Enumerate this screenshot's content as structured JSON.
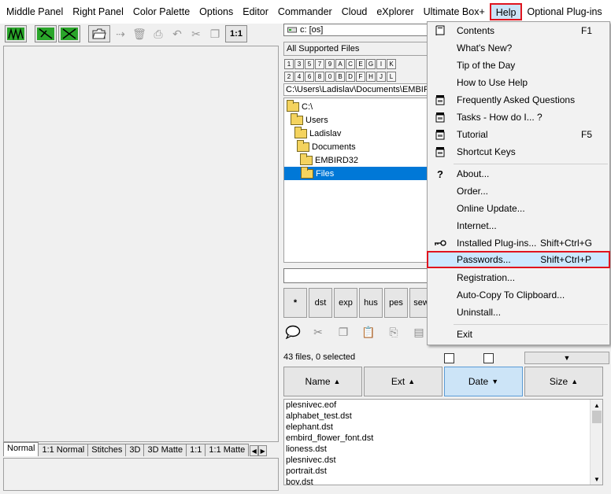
{
  "menubar": {
    "items": [
      {
        "label": "Middle Panel"
      },
      {
        "label": "Right Panel"
      },
      {
        "label": "Color Palette"
      },
      {
        "label": "Options"
      },
      {
        "label": "Editor"
      },
      {
        "label": "Commander"
      },
      {
        "label": "Cloud"
      },
      {
        "label": "eXplorer"
      },
      {
        "label": "Ultimate Box+"
      },
      {
        "label": "Help"
      },
      {
        "label": "Optional Plug-ins"
      }
    ]
  },
  "toolbar": {
    "zoom_label": "1:1"
  },
  "left_tabs": [
    {
      "label": "Normal"
    },
    {
      "label": "1:1 Normal"
    },
    {
      "label": "Stitches"
    },
    {
      "label": "3D"
    },
    {
      "label": "3D Matte"
    },
    {
      "label": "1:1"
    },
    {
      "label": "1:1 Matte"
    }
  ],
  "right_panel": {
    "drive": "c: [os]",
    "filter": "All Supported Files",
    "keys_row1": [
      "1",
      "3",
      "5",
      "7",
      "9",
      "A",
      "C",
      "E",
      "G",
      "I",
      "K"
    ],
    "keys_row2": [
      "2",
      "4",
      "6",
      "8",
      "0",
      "B",
      "D",
      "F",
      "H",
      "J",
      "L"
    ],
    "path": "C:\\Users\\Ladislav\\Documents\\EMBIRD",
    "tree": [
      {
        "label": "C:\\"
      },
      {
        "label": "Users"
      },
      {
        "label": "Ladislav"
      },
      {
        "label": "Documents"
      },
      {
        "label": "EMBIRD32"
      },
      {
        "label": "Files"
      }
    ],
    "ext_buttons": [
      "*",
      "dst",
      "exp",
      "hus",
      "pes",
      "sew"
    ],
    "files_count": "43 files, 0 selected",
    "sort_buttons": [
      {
        "label": "Name",
        "arrow": "▲"
      },
      {
        "label": "Ext",
        "arrow": "▲"
      },
      {
        "label": "Date",
        "arrow": "▼"
      },
      {
        "label": "Size",
        "arrow": "▲"
      }
    ],
    "files": [
      "plesnivec.eof",
      "alphabet_test.dst",
      "elephant.dst",
      "embird_flower_font.dst",
      "lioness.dst",
      "plesnivec.dst",
      "portrait.dst",
      "boy.dst"
    ]
  },
  "help_menu": {
    "items": [
      {
        "label": "Contents",
        "shortcut": "F1",
        "icon": "book-icon"
      },
      {
        "label": "What's New?",
        "shortcut": ""
      },
      {
        "label": "Tip of the Day",
        "shortcut": ""
      },
      {
        "label": "How to Use Help",
        "shortcut": ""
      },
      {
        "label": "Frequently Asked Questions",
        "shortcut": "",
        "icon": "video-icon"
      },
      {
        "label": "Tasks - How do I... ?",
        "shortcut": "",
        "icon": "video-icon"
      },
      {
        "label": "Tutorial",
        "shortcut": "F5",
        "icon": "video-icon"
      },
      {
        "label": "Shortcut Keys",
        "shortcut": "",
        "icon": "video-icon"
      },
      {
        "label": "About...",
        "shortcut": "",
        "icon": "question-icon"
      },
      {
        "label": "Order...",
        "shortcut": ""
      },
      {
        "label": "Online Update...",
        "shortcut": ""
      },
      {
        "label": "Internet...",
        "shortcut": ""
      },
      {
        "label": "Installed Plug-ins...",
        "shortcut": "Shift+Ctrl+G",
        "icon": "key-icon"
      },
      {
        "label": "Passwords...",
        "shortcut": "Shift+Ctrl+P"
      },
      {
        "label": "Registration...",
        "shortcut": ""
      },
      {
        "label": "Auto-Copy To Clipboard...",
        "shortcut": ""
      },
      {
        "label": "Uninstall...",
        "shortcut": ""
      },
      {
        "label": "Exit",
        "shortcut": ""
      }
    ]
  },
  "colors": {
    "highlight_border": "#e0141e",
    "selection": "#0078d7",
    "menu_hover": "#cce8ff"
  }
}
